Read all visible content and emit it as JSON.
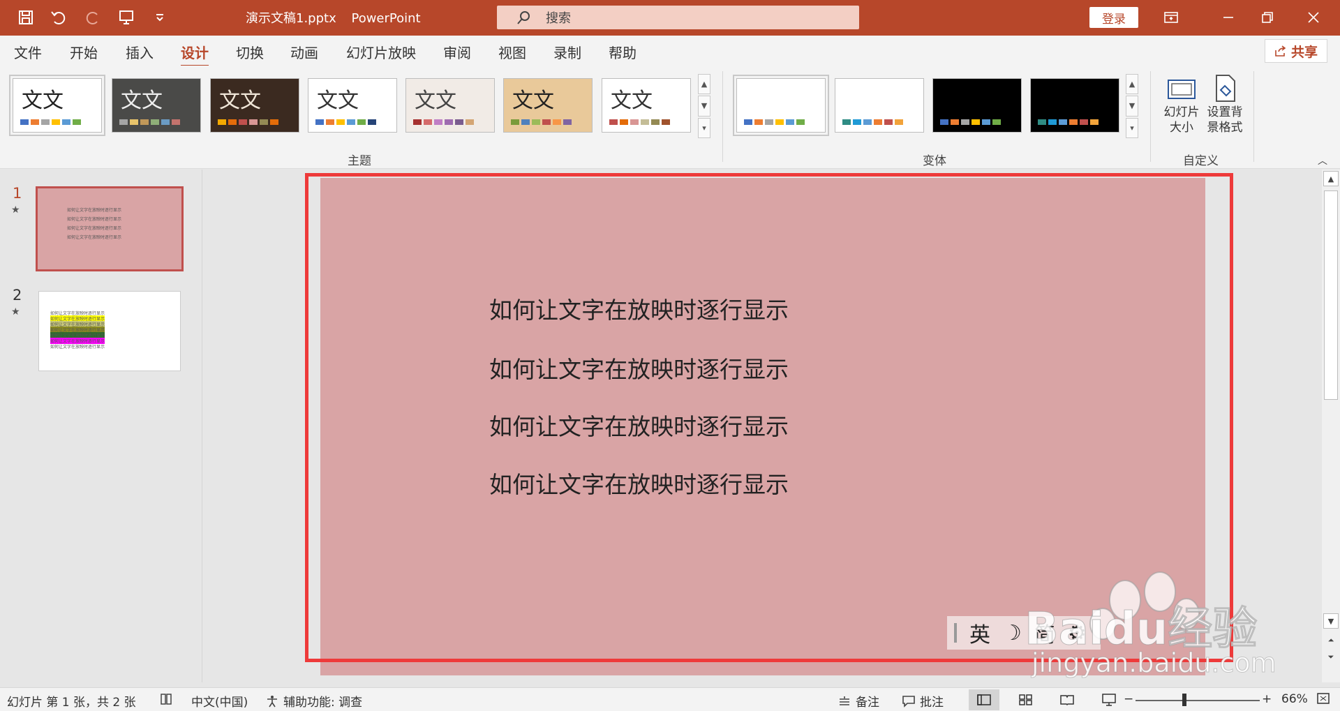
{
  "titlebar": {
    "filename": "演示文稿1.pptx",
    "app": "PowerPoint",
    "search_placeholder": "搜索",
    "login": "登录"
  },
  "menu": {
    "tabs": [
      "文件",
      "开始",
      "插入",
      "设计",
      "切换",
      "动画",
      "幻灯片放映",
      "审阅",
      "视图",
      "录制",
      "帮助"
    ],
    "active_tab": "设计",
    "share": "共享"
  },
  "ribbon": {
    "themes_label": "主题",
    "variants_label": "变体",
    "custom_label": "自定义",
    "theme_thumb_text": "文文",
    "slide_size_line1": "幻灯片",
    "slide_size_line2": "大小",
    "bg_format_line1": "设置背",
    "bg_format_line2": "景格式"
  },
  "slides_panel": {
    "slide1_number": "1",
    "slide2_number": "2"
  },
  "slide": {
    "lines": [
      "如何让文字在放映时逐行显示",
      "如何让文字在放映时逐行显示",
      "如何让文字在放映时逐行显示",
      "如何让文字在放映时逐行显示"
    ]
  },
  "ime": {
    "lang": "英",
    "width": "简"
  },
  "watermark": {
    "brand": "Baidu经验",
    "url": "jingyan.baidu.com"
  },
  "statusbar": {
    "slide_info": "幻灯片 第 1 张，共 2 张",
    "language": "中文(中国)",
    "accessibility": "辅助功能: 调查",
    "notes": "备注",
    "comments": "批注",
    "zoom": "66%"
  }
}
